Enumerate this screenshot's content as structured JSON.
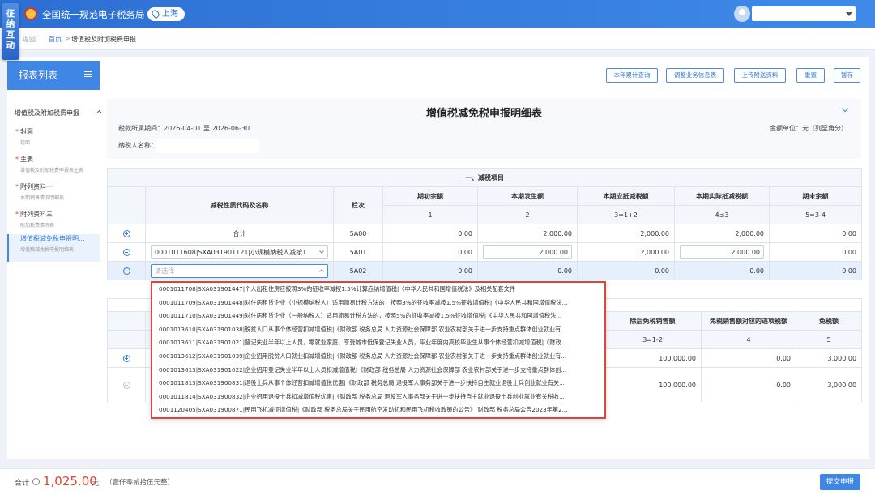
{
  "header": {
    "title": "全国统一规范电子税务局",
    "city": "上海",
    "side_tag": [
      "征",
      "纳",
      "互",
      "动"
    ]
  },
  "breadcrumb": {
    "back": "返回",
    "home": "首页",
    "sep": ">",
    "current": "增值税及附加税费申报"
  },
  "sidebar": {
    "title": "报表列表",
    "group": "增值税及附加税费申报",
    "items": [
      {
        "label": "封面",
        "sub": "封面",
        "req": "*"
      },
      {
        "label": "主表",
        "sub": "增值税及附加税费申报表主表",
        "req": "*"
      },
      {
        "label": "附列资料一",
        "sub": "本期销售情况明细表",
        "req": "*"
      },
      {
        "label": "附列资料三",
        "sub": "附加税费情况表",
        "req": "*"
      },
      {
        "label": "增值税减免税申报明...",
        "sub": "增值税减免税申报明细表",
        "req": ""
      }
    ]
  },
  "toolbar": {
    "b1": "本年累计查询",
    "b2": "调整业务信息表",
    "b3": "上传附送资料",
    "b4": "重置",
    "b5": "暂存"
  },
  "form": {
    "title": "增值税减免税申报明细表",
    "period": "税款所属期间：2026-04-01 至 2026-06-30",
    "unit": "金额单位：元（列至角分）",
    "taxpayer": "纳税人名称："
  },
  "table1": {
    "section": "一、减税项目",
    "h_code": "减税性质代码及名称",
    "h_line": "栏次",
    "cols": [
      "期初余额",
      "本期发生额",
      "本期应抵减税额",
      "本期实际抵减税额",
      "期末余额"
    ],
    "sub": [
      "1",
      "2",
      "3=1+2",
      "4≤3",
      "5=3-4"
    ],
    "rows": [
      {
        "name": "合计",
        "line": "5A00",
        "v": [
          "0.00",
          "2,000.00",
          "2,000.00",
          "2,000.00",
          "0.00"
        ]
      },
      {
        "name": "0001011608|SXA031901121|小规模纳税人减按1%征...",
        "line": "5A01",
        "v": [
          "0.00",
          "2,000.00",
          "2,000.00",
          "2,000.00",
          "0.00"
        ]
      },
      {
        "name": "请选择",
        "line": "5A02",
        "v": [
          "0.00",
          "0.00",
          "0.00",
          "0.00",
          "0.00"
        ]
      }
    ]
  },
  "table2": {
    "cols": [
      "除后免税销售额",
      "免税销售额\n对应的进项税额",
      "免税额"
    ],
    "c1": "免税销售额对应的进项税额",
    "sub": [
      "3=1-2",
      "4",
      "5"
    ],
    "rows": [
      {
        "v": [
          "100,000.00",
          "0.00",
          "3,000.00"
        ]
      },
      {
        "v": [
          "100,000.00",
          "0.00",
          "3,000.00"
        ]
      }
    ]
  },
  "dropdown": [
    "0001011708|SXA031901447|个人出租住房应按照3%的征收率减按1.5%计算应纳增值税|《中华人民共和国增值税法》及相关配套文件",
    "0001011709|SXA031901448|对住房租赁企业（小规模纳税人）适用简易计税方法的，按照3%的征收率减按1.5%征收增值税|《中华人民共和国增值税法...",
    "0001011710|SXA031901449|对住房租赁企业（一般纳税人）适用简易计税方法的，按照5%的征收率减按1.5%征收增值税|《中华人民共和国增值税法...",
    "0001013610|SXA031901038|脱贫人口从事个体经营扣减增值税|《财政部 税务总局 人力资源社会保障部 农业农村部关于进一步支持重点群体创业就业有...",
    "0001013611|SXA031901021|登记失业半年以上人员，零就业家庭、享受城市低保登记失业人员，毕业年度内高校毕业生从事个体经营扣减增值税|《财政...",
    "0001013612|SXA031901039|企业招用脱贫人口就业扣减增值税|《财政部 税务总局 人力资源社会保障部 农业农村部关于进一步支持重点群体创业就业有...",
    "0001013613|SXA031901022|企业招用登记失业半年以上人员扣减增值税|《财政部 税务总局 人力资源社会保障部 农业农村部关于进一步支持重点群体创...",
    "0001011813|SXA031900831|退役士兵从事个体经营扣减增值税优惠|《财政部 税务总局 退役军人事务部关于进一步扶持自主就业退役士兵创业就业有关...",
    "0001011814|SXA031900832|企业招用退役士兵扣减增值税优惠|《财政部 税务总局 退役军人事务部关于进一步扶持自主就业退役士兵创业就业有关税收...",
    "0001120405|SXA031900871|民用飞机减征增值税|《财政部 税务总局关于民用航空发动机和民用飞机税收政策的公告》 财政部 税务总局公告2023年第2..."
  ],
  "footer": {
    "label": "合计",
    "info": "i",
    "amount": "1,025.00",
    "unit": "元",
    "words": "（壹仟零贰拾伍元整）",
    "submit": "提交申报"
  },
  "colors": {
    "primary": "#3f86e5",
    "danger": "#e0432f"
  }
}
